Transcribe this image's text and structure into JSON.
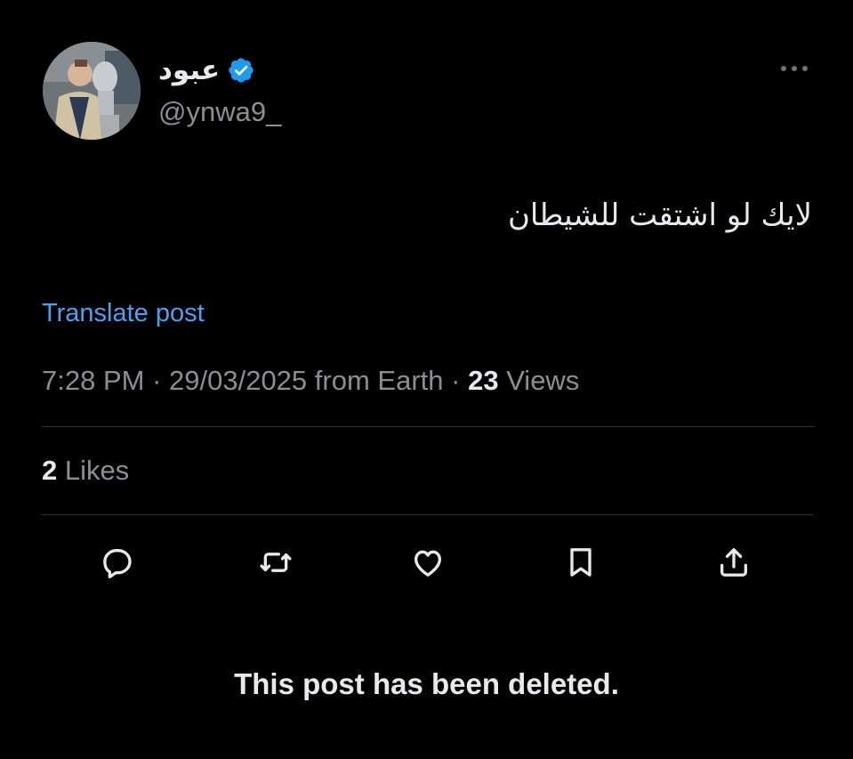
{
  "tweet": {
    "author": {
      "display_name": "عبود",
      "handle": "@ynwa9_",
      "verified_color": "#1d9bf0",
      "avatar_icon": "profile-photo"
    },
    "text": "لايك لو اشتقت للشيطان",
    "translate_label": "Translate post",
    "meta": {
      "time": "7:28 PM",
      "separator": " · ",
      "date": "29/03/2025",
      "location": "from Earth",
      "views_count": "23",
      "views_label": "Views"
    },
    "likes": {
      "count": "2",
      "label": "Likes"
    },
    "actions": [
      {
        "icon": "reply-icon"
      },
      {
        "icon": "repost-icon"
      },
      {
        "icon": "like-icon"
      },
      {
        "icon": "bookmark-icon"
      },
      {
        "icon": "share-icon"
      }
    ]
  },
  "notice": {
    "deleted_text": "This post has been deleted."
  },
  "colors": {
    "background": "#000000",
    "primary_text": "#e7e9ea",
    "secondary_text": "#8b8f94",
    "link": "#4aa3f0",
    "divider": "#2f3336"
  }
}
